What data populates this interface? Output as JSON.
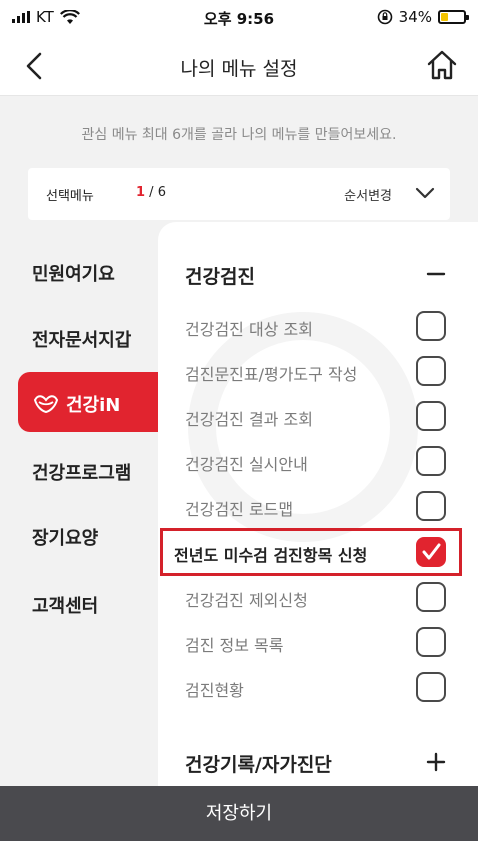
{
  "status_bar": {
    "carrier": "KT",
    "time": "오후 9:56",
    "battery_percent": "34%",
    "battery_level": 0.34
  },
  "header": {
    "title": "나의 메뉴 설정",
    "back_icon": "chevron-left-icon",
    "home_icon": "home-icon"
  },
  "info_text": "관심 메뉴 최대 6개를 골라 나의 메뉴를 만들어보세요.",
  "selection": {
    "label": "선택메뉴",
    "current": "1",
    "max": " / 6",
    "order_label": "순서변경"
  },
  "sidebar": {
    "items": [
      {
        "label": "민원여기요"
      },
      {
        "label": "전자문서지갑"
      },
      {
        "label": "건강iN",
        "active": true
      },
      {
        "label": "건강프로그램"
      },
      {
        "label": "장기요양"
      },
      {
        "label": "고객센터"
      }
    ]
  },
  "sections": [
    {
      "title": "건강검진",
      "expanded": true,
      "items": [
        {
          "label": "건강검진 대상 조회",
          "checked": false
        },
        {
          "label": "검진문진표/평가도구 작성",
          "checked": false
        },
        {
          "label": "건강검진 결과 조회",
          "checked": false
        },
        {
          "label": "건강검진 실시안내",
          "checked": false
        },
        {
          "label": "건강검진 로드맵",
          "checked": false
        },
        {
          "label": "전년도 미수검 검진항목 신청",
          "checked": true
        },
        {
          "label": "건강검진 제외신청",
          "checked": false
        },
        {
          "label": "검진 정보 목록",
          "checked": false
        },
        {
          "label": "검진현황",
          "checked": false
        }
      ]
    },
    {
      "title": "건강기록/자가진단",
      "expanded": false
    }
  ],
  "save_button": "저장하기",
  "colors": {
    "accent": "#e1242f",
    "save_bar": "#4a4a4e"
  }
}
